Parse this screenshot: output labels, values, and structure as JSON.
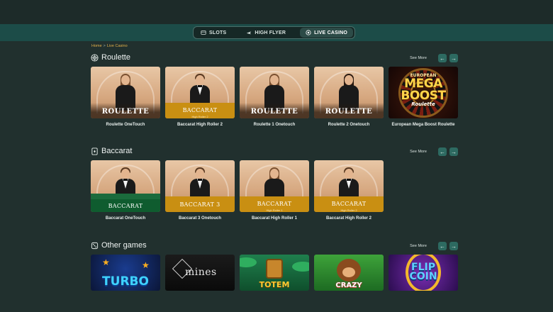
{
  "nav": {
    "tabs": [
      {
        "label": "SLOTS",
        "icon": "slot-machine-icon"
      },
      {
        "label": "HIGH FLYER",
        "icon": "airplane-icon"
      },
      {
        "label": "LIVE CASINO",
        "icon": "chip-icon",
        "active": true
      }
    ]
  },
  "breadcrumb": {
    "home": "Home",
    "separator": ">",
    "current": "Live Casino"
  },
  "sections": {
    "roulette": {
      "title": "Roulette",
      "see_more": "See More",
      "cards": [
        {
          "name": "Roulette OneTouch",
          "overlay": "ROULETTE"
        },
        {
          "name": "Baccarat High Roller 2",
          "overlay": "BACCARAT",
          "sub": "High Roller 2"
        },
        {
          "name": "Roulette 1 Onetouch",
          "overlay": "ROULETTE"
        },
        {
          "name": "Roulette 2 Onetouch",
          "overlay": "ROULETTE"
        },
        {
          "name": "European Mega Boost Roulette",
          "overlay_lines": [
            "EUROPEAN",
            "MEGA",
            "BOOST",
            "Roulette"
          ]
        }
      ]
    },
    "baccarat": {
      "title": "Baccarat",
      "see_more": "See More",
      "cards": [
        {
          "name": "Baccarat OneTouch",
          "overlay": "BACCARAT"
        },
        {
          "name": "Baccarat 3 Onetouch",
          "overlay": "BACCARAT 3"
        },
        {
          "name": "Baccarat High Roller 1",
          "overlay": "BACCARAT",
          "sub": "High Roller 1"
        },
        {
          "name": "Baccarat High Roller 2",
          "overlay": "BACCARAT",
          "sub": "High Roller 2"
        }
      ]
    },
    "other": {
      "title": "Other games",
      "see_more": "See More",
      "cards": [
        {
          "overlay": "TURBO"
        },
        {
          "overlay": "mines"
        },
        {
          "overlay": "TOTEM"
        },
        {
          "overlay": "CRAZY"
        },
        {
          "overlay_lines": [
            "FLIP",
            "COIN"
          ]
        }
      ]
    }
  },
  "colors": {
    "background": "#21302e",
    "nav_band": "#1c4c48",
    "accent_gold": "#c98f12",
    "breadcrumb": "#e2b04a",
    "arrow_button": "#2d6a61"
  }
}
